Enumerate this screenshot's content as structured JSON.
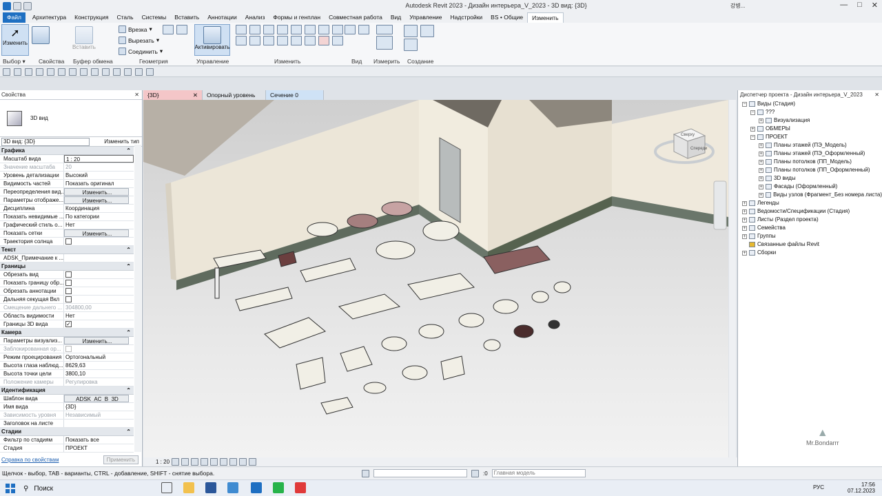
{
  "app": {
    "title": "Autodesk Revit 2023 - Дизайн интерьера_V_2023 - 3D вид: {3D}",
    "user": "강병...",
    "controls": [
      "—",
      "□",
      "✕"
    ]
  },
  "tabs": [
    "Файл",
    "Архитектура",
    "Конструкция",
    "Сталь",
    "Системы",
    "Вставить",
    "Аннотации",
    "Анализ",
    "Формы и генплан",
    "Совместная работа",
    "Вид",
    "Управление",
    "Надстройки",
    "BS • Общие",
    "Изменить"
  ],
  "ribbon": {
    "modify": "Изменить",
    "paste": "Вставить",
    "cut_items": [
      "Врезка",
      "Вырезать",
      "Соединить"
    ],
    "activate": "Активировать",
    "panels": [
      "Выбор",
      "Свойства",
      "Буфер обмена",
      "Геометрия",
      "Управление",
      "Изменить",
      "Вид",
      "Измерить",
      "Создание"
    ]
  },
  "properties": {
    "title": "Свойства",
    "type_name": "3D вид",
    "selector": "3D вид: {3D}",
    "edit_type": "Изменить тип",
    "help": "Справка по свойствам",
    "apply": "Применить",
    "groups": [
      {
        "name": "Графика",
        "rows": [
          {
            "k": "Масштаб вида",
            "v": "1 : 20",
            "kind": "box"
          },
          {
            "k": "Значение масштаба",
            "v": "20",
            "kind": "dim"
          },
          {
            "k": "Уровень детализации",
            "v": "Высокий"
          },
          {
            "k": "Видимость частей",
            "v": "Показать оригинал"
          },
          {
            "k": "Переопределения вид...",
            "v": "Изменить...",
            "kind": "btn"
          },
          {
            "k": "Параметры отображе...",
            "v": "Изменить...",
            "kind": "btn"
          },
          {
            "k": "Дисциплина",
            "v": "Координация"
          },
          {
            "k": "Показать невидимые ...",
            "v": "По категории"
          },
          {
            "k": "Графический стиль о...",
            "v": "Нет"
          },
          {
            "k": "Показать сетки",
            "v": "Изменить...",
            "kind": "btn"
          },
          {
            "k": "Траектория солнца",
            "v": "",
            "kind": "chk"
          }
        ]
      },
      {
        "name": "Текст",
        "rows": [
          {
            "k": "ADSK_Примечание к ...",
            "v": ""
          }
        ]
      },
      {
        "name": "Границы",
        "rows": [
          {
            "k": "Обрезать вид",
            "v": "",
            "kind": "chk"
          },
          {
            "k": "Показать границу обр...",
            "v": "",
            "kind": "chk"
          },
          {
            "k": "Обрезать аннотации",
            "v": "",
            "kind": "chk"
          },
          {
            "k": "Дальняя секущая Вкл",
            "v": "",
            "kind": "chk"
          },
          {
            "k": "Смещение дальнего ...",
            "v": "304800,00",
            "kind": "dim"
          },
          {
            "k": "Область видимости",
            "v": "Нет"
          },
          {
            "k": "Границы 3D вида",
            "v": "✓",
            "kind": "chk"
          }
        ]
      },
      {
        "name": "Камера",
        "rows": [
          {
            "k": "Параметры визуализ...",
            "v": "Изменить...",
            "kind": "btn"
          },
          {
            "k": "Заблокированная ор...",
            "v": "",
            "kind": "dimchk"
          },
          {
            "k": "Режим проецирования",
            "v": "Ортогональный"
          },
          {
            "k": "Высота глаза наблюд...",
            "v": "8629,63"
          },
          {
            "k": "Высота точки цели",
            "v": "3800,10"
          },
          {
            "k": "Положение камеры",
            "v": "Регулировка",
            "kind": "dim"
          }
        ]
      },
      {
        "name": "Идентификация",
        "rows": [
          {
            "k": "Шаблон вида",
            "v": "ADSK_АС_В_3D",
            "kind": "btn"
          },
          {
            "k": "Имя вида",
            "v": "{3D}"
          },
          {
            "k": "Зависимость уровня",
            "v": "Независимый",
            "kind": "dim"
          },
          {
            "k": "Заголовок на листе",
            "v": ""
          }
        ]
      },
      {
        "name": "Стадии",
        "rows": [
          {
            "k": "Фильтр по стадиям",
            "v": "Показать все"
          },
          {
            "k": "Стадия",
            "v": "ПРОЕКТ"
          }
        ]
      }
    ]
  },
  "view_tabs": [
    {
      "label": "{3D}",
      "style": "red"
    },
    {
      "label": "Опорный уровень",
      "style": "gray"
    },
    {
      "label": "Сечение 0",
      "style": "blue"
    }
  ],
  "view_scale": "1 : 20",
  "browser": {
    "title": "Диспетчер проекта - Дизайн интерьера_V_2023",
    "items": [
      {
        "label": "Виды (Стадия)",
        "lvl": 0,
        "pm": "-"
      },
      {
        "label": "???",
        "lvl": 1,
        "pm": "-"
      },
      {
        "label": "Визуализация",
        "lvl": 2,
        "pm": "+"
      },
      {
        "label": "ОБМЕРЫ",
        "lvl": 1,
        "pm": "+"
      },
      {
        "label": "ПРОЕКТ",
        "lvl": 1,
        "pm": "-"
      },
      {
        "label": "Планы этажей (ПЭ_Модель)",
        "lvl": 2,
        "pm": "+"
      },
      {
        "label": "Планы этажей (ПЭ_Оформленный)",
        "lvl": 2,
        "pm": "+"
      },
      {
        "label": "Планы потолков (ПП_Модель)",
        "lvl": 2,
        "pm": "+"
      },
      {
        "label": "Планы потолков (ПП_Оформленный)",
        "lvl": 2,
        "pm": "+"
      },
      {
        "label": "3D виды",
        "lvl": 2,
        "pm": "+"
      },
      {
        "label": "Фасады (Оформленный)",
        "lvl": 2,
        "pm": "+"
      },
      {
        "label": "Виды узлов (Фрагмент_Без номера листа)",
        "lvl": 2,
        "pm": "+"
      },
      {
        "label": "Легенды",
        "lvl": 0,
        "pm": "+"
      },
      {
        "label": "Ведомости/Спецификации (Стадия)",
        "lvl": 0,
        "pm": "+"
      },
      {
        "label": "Листы (Раздел проекта)",
        "lvl": 0,
        "pm": "+"
      },
      {
        "label": "Семейства",
        "lvl": 0,
        "pm": "+"
      },
      {
        "label": "Группы",
        "lvl": 0,
        "pm": "+"
      },
      {
        "label": "Связанные файлы Revit",
        "lvl": 0,
        "pm": ""
      },
      {
        "label": "Сборки",
        "lvl": 0,
        "pm": "+"
      }
    ]
  },
  "status": {
    "text": "Щелчок - выбор, TAB - варианты, CTRL - добавление, SHIFT - снятие выбора.",
    "count": ":0",
    "model": "Главная модель"
  },
  "taskbar": {
    "search": "Поиск",
    "lang": "РУС",
    "time": "17:56",
    "date": "07.12.2023"
  },
  "watermark": "Mr.Bondarrr",
  "viewcube": {
    "top": "Сверху",
    "front": "Спереди"
  }
}
